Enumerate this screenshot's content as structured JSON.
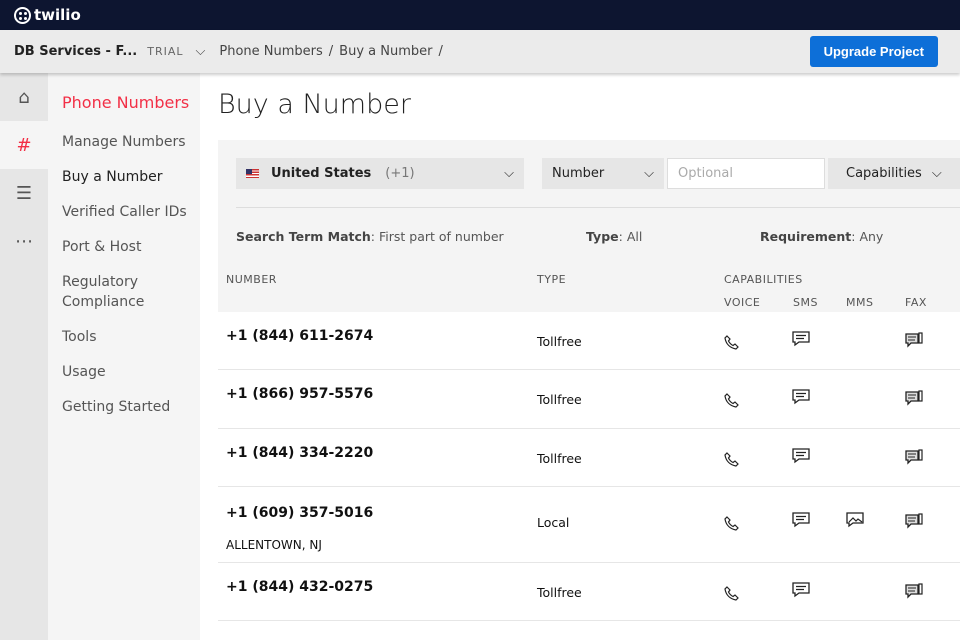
{
  "brand": "twilio",
  "header": {
    "account": "DB Services - F...",
    "plan": "TRIAL",
    "breadcrumb": [
      "Phone Numbers",
      "Buy a Number"
    ],
    "upgrade_label": "Upgrade Project"
  },
  "sidebar": {
    "title": "Phone Numbers",
    "items": [
      "Manage Numbers",
      "Buy a Number",
      "Verified Caller IDs",
      "Port & Host",
      "Regulatory Compliance",
      "Tools",
      "Usage",
      "Getting Started"
    ]
  },
  "page": {
    "title": "Buy a Number"
  },
  "filters": {
    "country": "United States",
    "country_code": "(+1)",
    "search_by": "Number",
    "search_placeholder": "Optional",
    "capabilities_label": "Capabilities"
  },
  "meta": {
    "match_label": "Search Term Match",
    "match_value": "First part of number",
    "type_label": "Type",
    "type_value": "All",
    "req_label": "Requirement",
    "req_value": "Any"
  },
  "columns": {
    "number": "NUMBER",
    "type": "TYPE",
    "capabilities": "CAPABILITIES",
    "voice": "VOICE",
    "sms": "SMS",
    "mms": "MMS",
    "fax": "FAX"
  },
  "rows": [
    {
      "number": "+1 (844) 611-2674",
      "type": "Tollfree",
      "location": "",
      "mms": false
    },
    {
      "number": "+1 (866) 957-5576",
      "type": "Tollfree",
      "location": "",
      "mms": false
    },
    {
      "number": "+1 (844) 334-2220",
      "type": "Tollfree",
      "location": "",
      "mms": false
    },
    {
      "number": "+1 (609) 357-5016",
      "type": "Local",
      "location": "ALLENTOWN, NJ",
      "mms": true
    },
    {
      "number": "+1 (844) 432-0275",
      "type": "Tollfree",
      "location": "",
      "mms": false
    }
  ]
}
